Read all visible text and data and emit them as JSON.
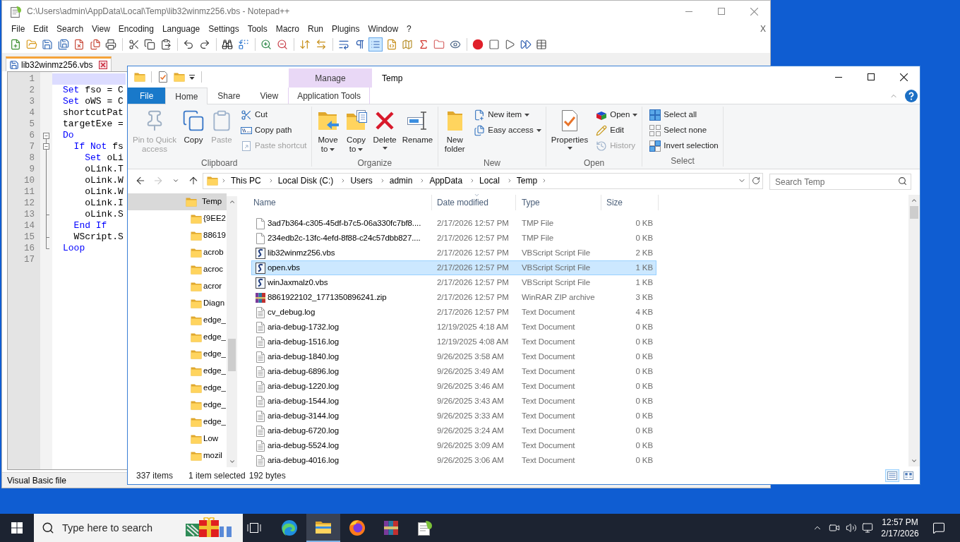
{
  "notepad": {
    "title": "C:\\Users\\admin\\AppData\\Local\\Temp\\lib32winmz256.vbs - Notepad++",
    "menu": [
      "File",
      "Edit",
      "Search",
      "View",
      "Encoding",
      "Language",
      "Settings",
      "Tools",
      "Macro",
      "Run",
      "Plugins",
      "Window",
      "?"
    ],
    "menu_close": "X",
    "toolbar": [
      [
        {
          "kind": "new",
          "pressed": false
        },
        {
          "kind": "open",
          "pressed": false
        },
        {
          "kind": "save",
          "pressed": false
        },
        {
          "kind": "save-all",
          "pressed": false
        },
        {
          "kind": "close",
          "pressed": false
        },
        {
          "kind": "close-all",
          "pressed": false
        },
        {
          "kind": "print",
          "pressed": false
        }
      ],
      [
        {
          "kind": "cut",
          "pressed": false
        },
        {
          "kind": "copy",
          "pressed": false
        },
        {
          "kind": "paste",
          "pressed": false
        }
      ],
      [
        {
          "kind": "undo",
          "pressed": false
        },
        {
          "kind": "redo",
          "pressed": false
        }
      ],
      [
        {
          "kind": "find",
          "pressed": false
        },
        {
          "kind": "replace",
          "pressed": false
        }
      ],
      [
        {
          "kind": "zoom-in",
          "pressed": false
        },
        {
          "kind": "zoom-out",
          "pressed": false
        }
      ],
      [
        {
          "kind": "sync-vertical",
          "pressed": false
        },
        {
          "kind": "sync-horizontal",
          "pressed": false
        }
      ],
      [
        {
          "kind": "word-wrap",
          "pressed": false
        },
        {
          "kind": "all-chars",
          "pressed": false
        },
        {
          "kind": "indent-guide",
          "pressed": true
        },
        {
          "kind": "language",
          "pressed": false
        },
        {
          "kind": "doc-map",
          "pressed": false
        },
        {
          "kind": "function-list",
          "pressed": false
        },
        {
          "kind": "folder-workspace",
          "pressed": false
        },
        {
          "kind": "monitoring",
          "pressed": false
        }
      ],
      [
        {
          "kind": "record",
          "pressed": false
        },
        {
          "kind": "stop",
          "pressed": false
        },
        {
          "kind": "play",
          "pressed": false
        },
        {
          "kind": "play-multiple",
          "pressed": false
        },
        {
          "kind": "save-macro",
          "pressed": false
        }
      ]
    ],
    "tabs": [
      {
        "label": "lib32winmz256.vbs",
        "selected": true
      }
    ],
    "lines": [
      {
        "number": "1",
        "kind": "plain",
        "current": true
      },
      {
        "number": "2",
        "kind": "plain",
        "current": false,
        "tokens": [
          {
            "text": "Set",
            "kind": "keyword"
          },
          {
            "text": " fso = C",
            "kind": "plain"
          }
        ]
      },
      {
        "number": "3",
        "kind": "plain",
        "current": false,
        "tokens": [
          {
            "text": "Set",
            "kind": "keyword"
          },
          {
            "text": " oWS = C",
            "kind": "plain"
          }
        ]
      },
      {
        "number": "4",
        "kind": "plain",
        "current": false,
        "tokens": [
          {
            "text": "shortcutPat",
            "kind": "plain"
          }
        ]
      },
      {
        "number": "5",
        "kind": "plain",
        "current": false,
        "tokens": [
          {
            "text": "targetExe =",
            "kind": "plain"
          }
        ]
      },
      {
        "number": "6",
        "kind": "fold-head",
        "current": false,
        "tokens": [
          {
            "text": "Do",
            "kind": "keyword"
          }
        ]
      },
      {
        "number": "7",
        "kind": "fold-nested-head",
        "current": false,
        "tokens": [
          {
            "text": "  If Not",
            "kind": "keyword"
          },
          {
            "text": " fs",
            "kind": "plain"
          }
        ]
      },
      {
        "number": "8",
        "kind": "fold-bar",
        "current": false,
        "tokens": [
          {
            "text": "    Set",
            "kind": "keyword"
          },
          {
            "text": " oLi",
            "kind": "plain"
          }
        ]
      },
      {
        "number": "9",
        "kind": "fold-bar",
        "current": false,
        "tokens": [
          {
            "text": "    oLink.T",
            "kind": "plain"
          }
        ]
      },
      {
        "number": "10",
        "kind": "fold-bar",
        "current": false,
        "tokens": [
          {
            "text": "    oLink.W",
            "kind": "plain"
          }
        ]
      },
      {
        "number": "11",
        "kind": "fold-bar",
        "current": false,
        "tokens": [
          {
            "text": "    oLink.W",
            "kind": "plain"
          }
        ]
      },
      {
        "number": "12",
        "kind": "fold-bar",
        "current": false,
        "tokens": [
          {
            "text": "    oLink.I",
            "kind": "plain"
          }
        ]
      },
      {
        "number": "13",
        "kind": "fold-tee",
        "current": false,
        "tokens": [
          {
            "text": "    oLink.S",
            "kind": "plain"
          }
        ]
      },
      {
        "number": "14",
        "kind": "fold-bar",
        "current": false,
        "tokens": [
          {
            "text": "  End If",
            "kind": "keyword"
          }
        ]
      },
      {
        "number": "15",
        "kind": "fold-tee",
        "current": false,
        "tokens": [
          {
            "text": "  WScript.S",
            "kind": "plain"
          }
        ]
      },
      {
        "number": "16",
        "kind": "fold-end",
        "current": false,
        "tokens": [
          {
            "text": "Loop",
            "kind": "keyword"
          }
        ]
      },
      {
        "number": "17",
        "kind": "plain",
        "current": false
      }
    ],
    "status_bar": {
      "file_type": "Visual Basic file"
    }
  },
  "explorer": {
    "context_group": {
      "label": "Manage"
    },
    "title": "Temp",
    "ribbon_tabs": [
      {
        "label": "File",
        "kind": "file",
        "selected": false
      },
      {
        "label": "Home",
        "kind": "standard",
        "selected": true
      },
      {
        "label": "Share",
        "kind": "standard",
        "selected": false
      },
      {
        "label": "View",
        "kind": "standard",
        "selected": false
      },
      {
        "label": "Application Tools",
        "kind": "contextual",
        "selected": false
      }
    ],
    "ribbon_groups": [
      {
        "label": "Clipboard",
        "columns": [
          {
            "kind": "large",
            "items": [
              {
                "kind": "pin",
                "lines": [
                  "Pin to Quick",
                  "access"
                ],
                "disabled": true,
                "dropdown": false
              }
            ]
          },
          {
            "kind": "large",
            "items": [
              {
                "kind": "copy",
                "lines": [
                  "Copy"
                ],
                "disabled": false,
                "dropdown": false
              }
            ]
          },
          {
            "kind": "large",
            "items": [
              {
                "kind": "paste",
                "lines": [
                  "Paste"
                ],
                "disabled": true,
                "dropdown": false
              }
            ]
          },
          {
            "kind": "stack",
            "items": [
              {
                "kind": "cut",
                "lines": [
                  "Cut"
                ],
                "disabled": false,
                "dropdown": false
              },
              {
                "kind": "copy-path",
                "lines": [
                  "Copy path"
                ],
                "disabled": false,
                "dropdown": false
              },
              {
                "kind": "paste-shortcut",
                "lines": [
                  "Paste shortcut"
                ],
                "disabled": true,
                "dropdown": false
              }
            ]
          }
        ]
      },
      {
        "label": "Organize",
        "columns": [
          {
            "kind": "large",
            "items": [
              {
                "kind": "move-to",
                "lines": [
                  "Move",
                  "to"
                ],
                "disabled": false,
                "dropdown": true
              }
            ]
          },
          {
            "kind": "large",
            "items": [
              {
                "kind": "copy-to",
                "lines": [
                  "Copy",
                  "to"
                ],
                "disabled": false,
                "dropdown": true
              }
            ]
          },
          {
            "kind": "large",
            "items": [
              {
                "kind": "delete",
                "lines": [
                  "Delete"
                ],
                "disabled": false,
                "dropdown": true
              }
            ]
          },
          {
            "kind": "large",
            "items": [
              {
                "kind": "rename",
                "lines": [
                  "Rename"
                ],
                "disabled": false,
                "dropdown": false
              }
            ]
          }
        ]
      },
      {
        "label": "New",
        "columns": [
          {
            "kind": "large",
            "items": [
              {
                "kind": "new-folder",
                "lines": [
                  "New",
                  "folder"
                ],
                "disabled": false,
                "dropdown": false
              }
            ]
          },
          {
            "kind": "stack",
            "items": [
              {
                "kind": "new-item",
                "lines": [
                  "New item"
                ],
                "disabled": false,
                "dropdown": true
              },
              {
                "kind": "easy-access",
                "lines": [
                  "Easy access"
                ],
                "disabled": false,
                "dropdown": true
              }
            ]
          }
        ]
      },
      {
        "label": "Open",
        "columns": [
          {
            "kind": "large",
            "items": [
              {
                "kind": "properties",
                "lines": [
                  "Properties"
                ],
                "disabled": false,
                "dropdown": true
              }
            ]
          },
          {
            "kind": "stack",
            "items": [
              {
                "kind": "open",
                "lines": [
                  "Open"
                ],
                "disabled": false,
                "dropdown": true
              },
              {
                "kind": "edit",
                "lines": [
                  "Edit"
                ],
                "disabled": false,
                "dropdown": false
              },
              {
                "kind": "history",
                "lines": [
                  "History"
                ],
                "disabled": true,
                "dropdown": false
              }
            ]
          }
        ]
      },
      {
        "label": "Select",
        "columns": [
          {
            "kind": "stack",
            "items": [
              {
                "kind": "select-all",
                "lines": [
                  "Select all"
                ],
                "disabled": false,
                "dropdown": false
              },
              {
                "kind": "select-none",
                "lines": [
                  "Select none"
                ],
                "disabled": false,
                "dropdown": false
              },
              {
                "kind": "invert-selection",
                "lines": [
                  "Invert selection"
                ],
                "disabled": false,
                "dropdown": false
              }
            ]
          }
        ]
      }
    ],
    "nav_buttons": [
      {
        "kind": "back",
        "disabled": false
      },
      {
        "kind": "forward",
        "disabled": true
      },
      {
        "kind": "recent",
        "disabled": false
      },
      {
        "kind": "up",
        "disabled": false
      }
    ],
    "address": {
      "crumbs": [
        "This PC",
        "Local Disk (C:)",
        "Users",
        "admin",
        "AppData",
        "Local",
        "Temp"
      ]
    },
    "search": {
      "placeholder": "Search Temp"
    },
    "nav_pane": [
      {
        "label": "Temp",
        "selected": true,
        "children": [
          {
            "label": "{9EE2",
            "selected": false
          },
          {
            "label": "88619",
            "selected": false
          },
          {
            "label": "acrob",
            "selected": false
          },
          {
            "label": "acroc",
            "selected": false
          },
          {
            "label": "acror",
            "selected": false
          },
          {
            "label": "Diagn",
            "selected": false
          },
          {
            "label": "edge_",
            "selected": false
          },
          {
            "label": "edge_",
            "selected": false
          },
          {
            "label": "edge_",
            "selected": false
          },
          {
            "label": "edge_",
            "selected": false
          },
          {
            "label": "edge_",
            "selected": false
          },
          {
            "label": "edge_",
            "selected": false
          },
          {
            "label": "edge_",
            "selected": false
          },
          {
            "label": "Low",
            "selected": false
          },
          {
            "label": "mozil",
            "selected": false
          }
        ]
      }
    ],
    "columns": [
      {
        "label": "Name",
        "sorted": false
      },
      {
        "label": "Date modified",
        "sorted": true
      },
      {
        "label": "Type",
        "sorted": false
      },
      {
        "label": "Size",
        "sorted": false
      }
    ],
    "rows": [
      {
        "kind": "tmp",
        "name": "3ad7b364-c305-45df-b7c5-06a330fc7bf8....",
        "date": "2/17/2026 12:57 PM",
        "type": "TMP File",
        "size": "0 KB",
        "selected": false
      },
      {
        "kind": "tmp",
        "name": "234edb2c-13fc-4efd-8f88-c24c57dbb827....",
        "date": "2/17/2026 12:57 PM",
        "type": "TMP File",
        "size": "0 KB",
        "selected": false
      },
      {
        "kind": "vbs",
        "name": "lib32winmz256.vbs",
        "date": "2/17/2026 12:57 PM",
        "type": "VBScript Script File",
        "size": "2 KB",
        "selected": false
      },
      {
        "kind": "vbs",
        "name": "open.vbs",
        "date": "2/17/2026 12:57 PM",
        "type": "VBScript Script File",
        "size": "1 KB",
        "selected": true
      },
      {
        "kind": "vbs",
        "name": "winJaxmalz0.vbs",
        "date": "2/17/2026 12:57 PM",
        "type": "VBScript Script File",
        "size": "1 KB",
        "selected": false
      },
      {
        "kind": "zip",
        "name": "8861922102_1771350896241.zip",
        "date": "2/17/2026 12:57 PM",
        "type": "WinRAR ZIP archive",
        "size": "3 KB",
        "selected": false
      },
      {
        "kind": "text",
        "name": "cv_debug.log",
        "date": "2/17/2026 12:57 PM",
        "type": "Text Document",
        "size": "4 KB",
        "selected": false
      },
      {
        "kind": "text",
        "name": "aria-debug-1732.log",
        "date": "12/19/2025 4:18 AM",
        "type": "Text Document",
        "size": "0 KB",
        "selected": false
      },
      {
        "kind": "text",
        "name": "aria-debug-1516.log",
        "date": "12/19/2025 4:08 AM",
        "type": "Text Document",
        "size": "0 KB",
        "selected": false
      },
      {
        "kind": "text",
        "name": "aria-debug-1840.log",
        "date": "9/26/2025 3:58 AM",
        "type": "Text Document",
        "size": "0 KB",
        "selected": false
      },
      {
        "kind": "text",
        "name": "aria-debug-6896.log",
        "date": "9/26/2025 3:49 AM",
        "type": "Text Document",
        "size": "0 KB",
        "selected": false
      },
      {
        "kind": "text",
        "name": "aria-debug-1220.log",
        "date": "9/26/2025 3:46 AM",
        "type": "Text Document",
        "size": "0 KB",
        "selected": false
      },
      {
        "kind": "text",
        "name": "aria-debug-1544.log",
        "date": "9/26/2025 3:43 AM",
        "type": "Text Document",
        "size": "0 KB",
        "selected": false
      },
      {
        "kind": "text",
        "name": "aria-debug-3144.log",
        "date": "9/26/2025 3:33 AM",
        "type": "Text Document",
        "size": "0 KB",
        "selected": false
      },
      {
        "kind": "text",
        "name": "aria-debug-6720.log",
        "date": "9/26/2025 3:24 AM",
        "type": "Text Document",
        "size": "0 KB",
        "selected": false
      },
      {
        "kind": "text",
        "name": "aria-debug-5524.log",
        "date": "9/26/2025 3:09 AM",
        "type": "Text Document",
        "size": "0 KB",
        "selected": false
      },
      {
        "kind": "text",
        "name": "aria-debug-4016.log",
        "date": "9/26/2025 3:06 AM",
        "type": "Text Document",
        "size": "0 KB",
        "selected": false
      }
    ],
    "status_bar": {
      "item_count": "337 items",
      "selection": "1 item selected",
      "selection_size": "192 bytes"
    },
    "view_modes": [
      {
        "kind": "details",
        "selected": true
      },
      {
        "kind": "large-icons",
        "selected": false
      }
    ]
  },
  "taskbar": {
    "search": {
      "placeholder": "Type here to search"
    },
    "apps": [
      {
        "kind": "task-view",
        "active": false
      },
      {
        "kind": "edge",
        "active": false
      },
      {
        "kind": "explorer",
        "active": true
      },
      {
        "kind": "firefox",
        "active": false
      },
      {
        "kind": "winrar",
        "active": false
      },
      {
        "kind": "notepad",
        "active": false
      }
    ],
    "clock": {
      "time": "12:57 PM",
      "date": "2/17/2026"
    }
  }
}
